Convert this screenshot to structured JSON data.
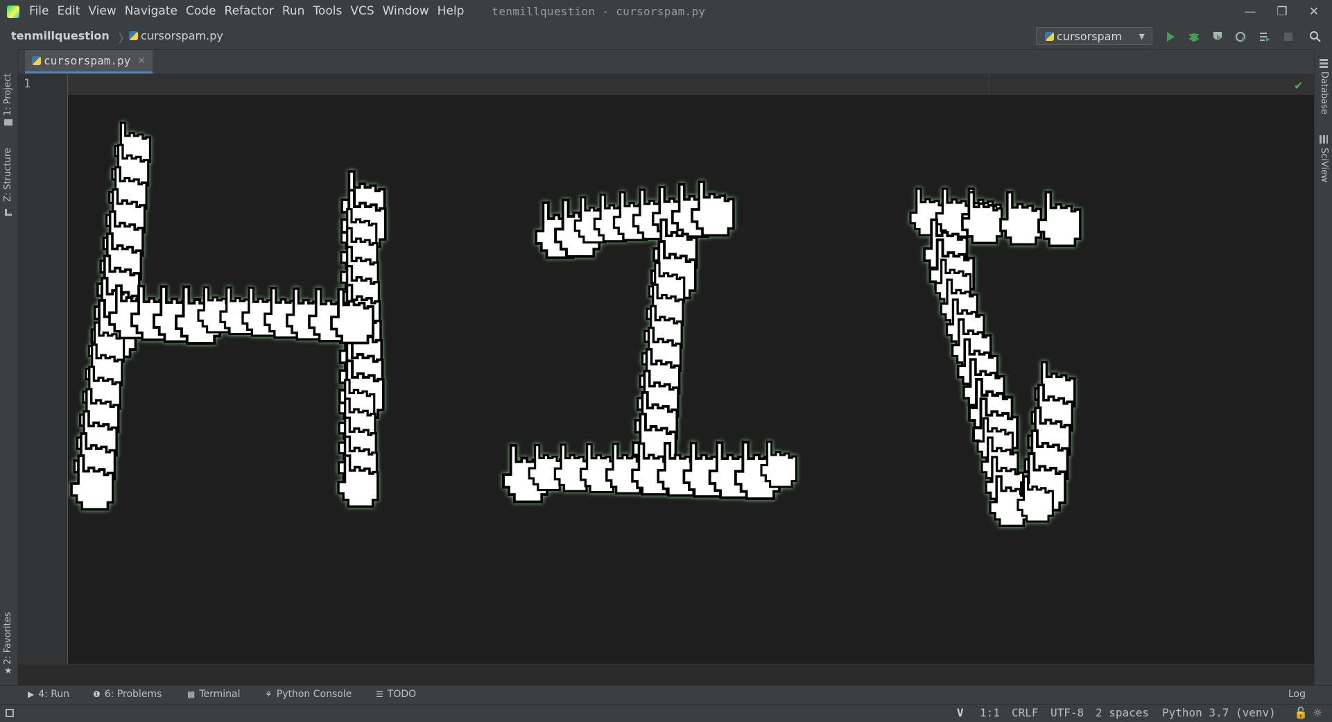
{
  "app": {
    "window_title": "tenmillquestion - cursorspam.py"
  },
  "menu": [
    "File",
    "Edit",
    "View",
    "Navigate",
    "Code",
    "Refactor",
    "Run",
    "Tools",
    "VCS",
    "Window",
    "Help"
  ],
  "breadcrumb": {
    "project": "tenmillquestion",
    "separator": "〉",
    "file": "cursorspam.py"
  },
  "run_config": "cursorspam",
  "tabs": [
    {
      "label": "cursorspam.py",
      "active": true
    }
  ],
  "editor": {
    "line_numbers": [
      "1"
    ]
  },
  "left_tools": [
    "1: Project",
    "Z: Structure",
    "2: Favorites"
  ],
  "right_tools": [
    "Database",
    "SciView"
  ],
  "bottom_tools": [
    {
      "label": "4: Run",
      "icon": "play-icon"
    },
    {
      "label": "6: Problems",
      "icon": "info-icon"
    },
    {
      "label": "Terminal",
      "icon": "terminal-icon"
    },
    {
      "label": "Python Console",
      "icon": "python-icon"
    },
    {
      "label": "TODO",
      "icon": "list-icon"
    }
  ],
  "event_log": "Log",
  "status": {
    "position": "1:1",
    "line_sep": "CRLF",
    "encoding": "UTF-8",
    "indent": "2 spaces",
    "interpreter": "Python 3.7 (venv)"
  },
  "colors": {
    "accent": "#4a88c7",
    "run_green": "#499c54",
    "cursor_fill": "#ffffff",
    "cursor_outline": "#000000",
    "glow": "#9fe6a0"
  },
  "art": {
    "description": "Cursor clones spell letters",
    "text": "HIY"
  }
}
